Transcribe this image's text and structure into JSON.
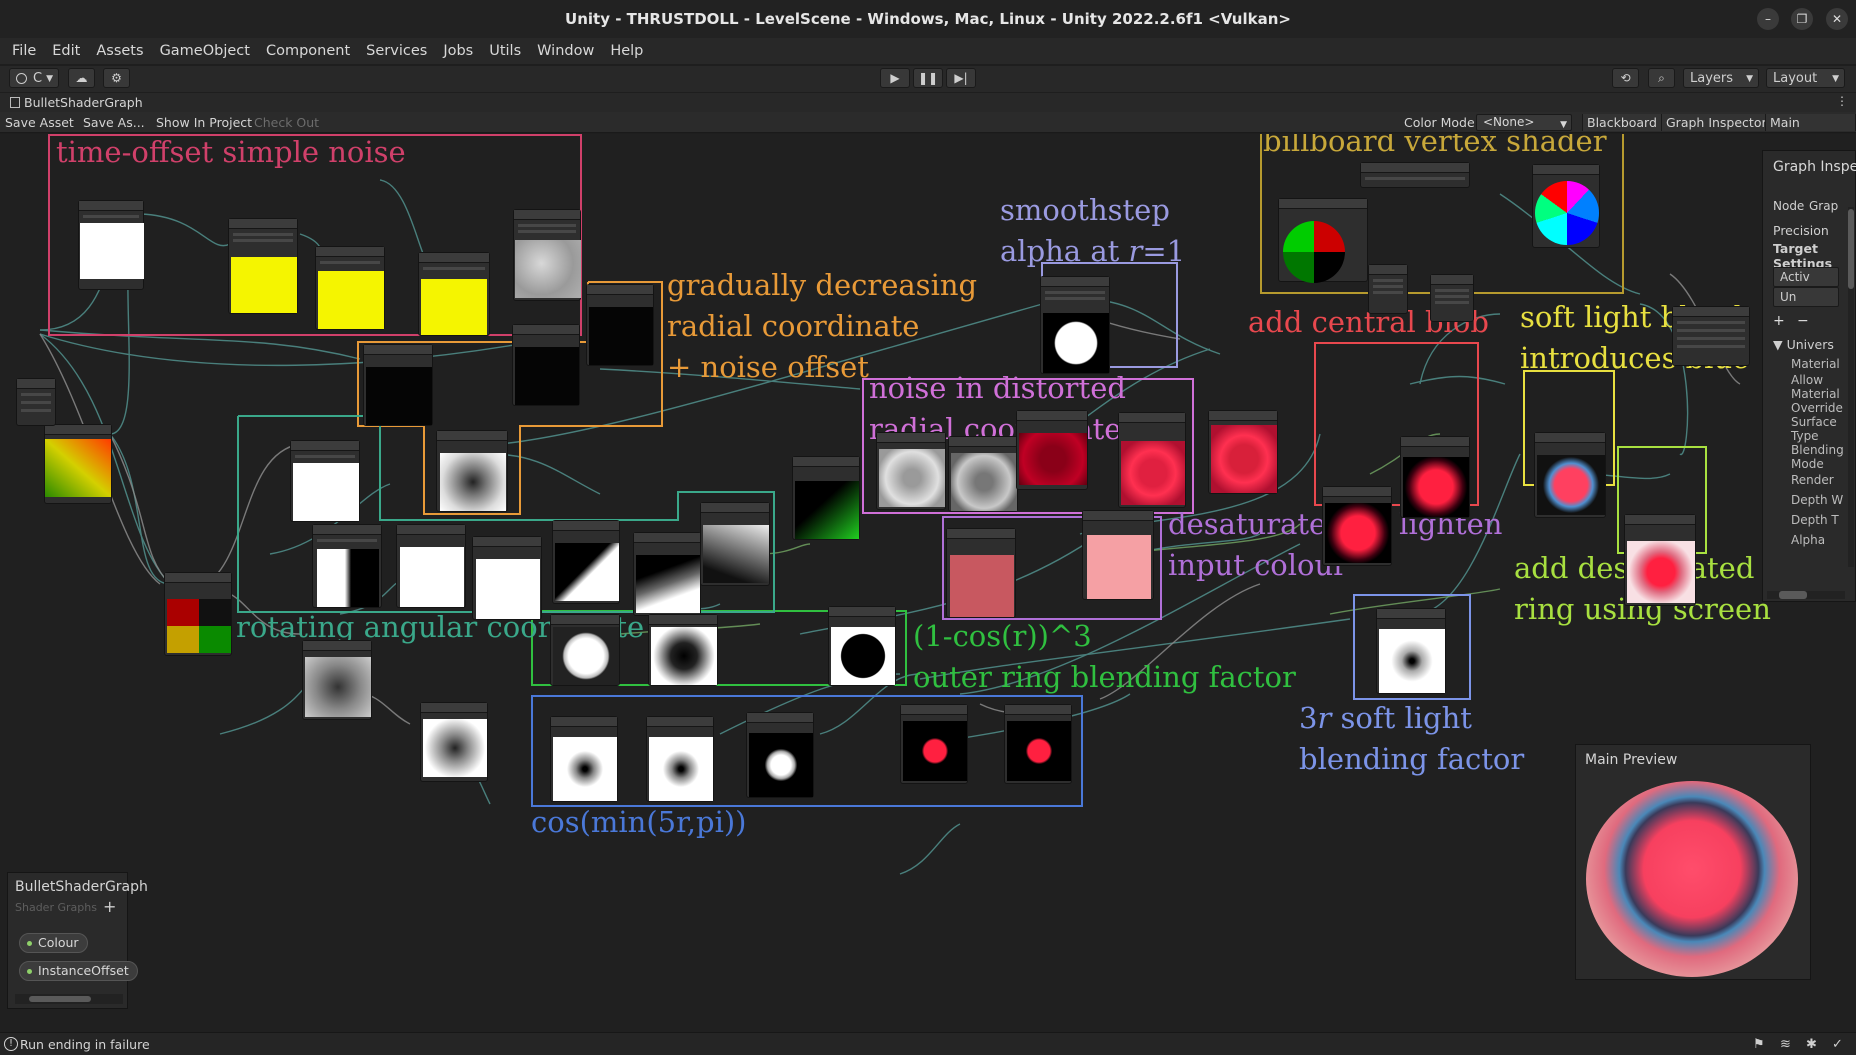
{
  "window": {
    "title": "Unity - THRUSTDOLL - LevelScene - Windows, Mac, Linux - Unity 2022.2.6f1 <Vulkan>",
    "controls": [
      "–",
      "❐",
      "✕"
    ]
  },
  "menu": [
    "File",
    "Edit",
    "Assets",
    "GameObject",
    "Component",
    "Services",
    "Jobs",
    "Utils",
    "Window",
    "Help"
  ],
  "toolbar": {
    "account_label": "C",
    "layers_label": "Layers",
    "layout_label": "Layout"
  },
  "tab": {
    "name": "BulletShaderGraph"
  },
  "graph_toolbar": {
    "save_asset": "Save Asset",
    "save_as": "Save As...",
    "show_in_project": "Show In Project",
    "check_out": "Check Out",
    "color_mode_label": "Color Mode",
    "color_mode_value": "<None>",
    "blackboard": "Blackboard",
    "graph_inspector": "Graph Inspector",
    "main_preview": "Main Preview"
  },
  "groups": [
    {
      "id": "time-offset",
      "label": "time-offset simple noise",
      "color": "#d0406a"
    },
    {
      "id": "billboard",
      "label": "billboard vertex shader",
      "color": "#b69a2e"
    },
    {
      "id": "smoothstep",
      "label": "smoothstep\nalpha at 𝑟=1",
      "color": "#9a9ae0"
    },
    {
      "id": "radial",
      "label": "gradually decreasing\nradial coordinate\n+ noise offset",
      "color": "#e89a38"
    },
    {
      "id": "noise-distorted",
      "label": "noise in distorted\nradial coordinates",
      "color": "#d070d8"
    },
    {
      "id": "central-blob",
      "label": "add central blob",
      "color": "#e8484e"
    },
    {
      "id": "soft-light",
      "label": "soft light blend\nintroduces blue",
      "color": "#e8e040"
    },
    {
      "id": "desaturate",
      "label": "desaturate and lighten\ninput colour",
      "color": "#b070d8"
    },
    {
      "id": "outer-ring",
      "label": "add desaturated outer\nring using screen",
      "color": "#a8e040"
    },
    {
      "id": "angular",
      "label": "rotating angular coordinate",
      "color": "#3aa88a"
    },
    {
      "id": "blend-factor",
      "label": "(1-cos(r))^3\nouter ring blending factor",
      "color": "#30c040"
    },
    {
      "id": "soft-light-factor",
      "label": "3𝑟 soft light\nblending factor",
      "color": "#7c94e8"
    },
    {
      "id": "cos",
      "label": "cos(min(5r,pi))",
      "color": "#4a78d8"
    }
  ],
  "inspector": {
    "title": "Graph Inspector",
    "tab_node": "Node",
    "tab_graph": "Grap",
    "precision": "Precision",
    "target_settings": "Target\nSettings",
    "active_field": "Activ",
    "second_field": "Un",
    "universal": "Univers",
    "props": [
      "Material",
      "Allow\nMaterial\nOverride",
      "Surface\nType",
      "Blending\nMode",
      "Render",
      "Depth W",
      "Depth T",
      "Alpha"
    ]
  },
  "blackboard": {
    "title": "BulletShaderGraph",
    "subtitle": "Shader Graphs",
    "properties": [
      "Colour",
      "InstanceOffset"
    ],
    "colors": {
      "property_dot": "#8fd16a"
    }
  },
  "main_preview": {
    "title": "Main Preview"
  },
  "status": {
    "message": "Run ending in failure"
  }
}
